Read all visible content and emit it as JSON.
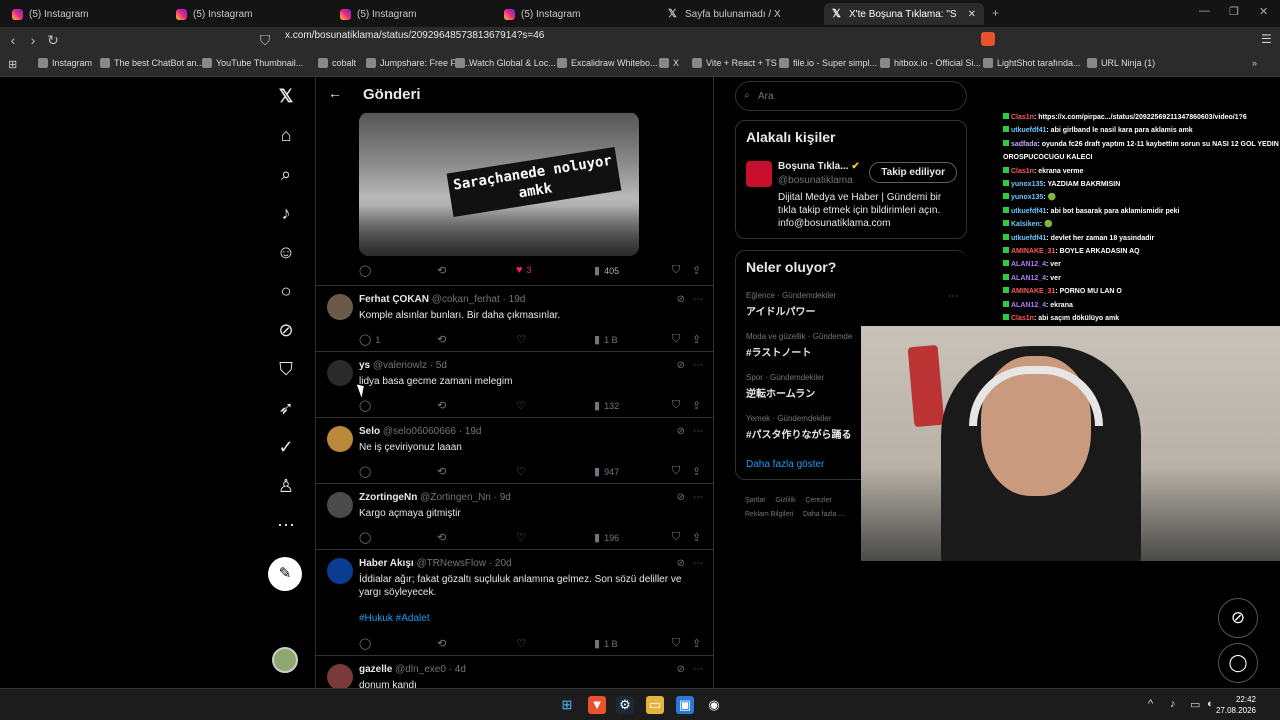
{
  "browser": {
    "tabs": [
      {
        "label": "(5) Instagram",
        "icon": "instagram-icon"
      },
      {
        "label": "(5) Instagram",
        "icon": "instagram-icon"
      },
      {
        "label": "(5) Instagram",
        "icon": "instagram-icon"
      },
      {
        "label": "(5) Instagram",
        "icon": "instagram-icon"
      },
      {
        "label": "Sayfa bulunamadı / X",
        "icon": "x-icon"
      },
      {
        "label": "X'te Boşuna Tıklama: \"SON DAKİ",
        "icon": "x-icon"
      }
    ],
    "url": "x.com/bosunatiklama/status/2092964857381367914?s=46",
    "bookmarks": [
      "Instagram",
      "The best ChatBot an...",
      "YouTube Thumbnail...",
      "cobalt",
      "Jumpshare: Free File...",
      "Watch Global & Loc...",
      "Excalidraw Whitebo...",
      "X",
      "Vite + React + TS",
      "file.io - Super simpl...",
      "hitbox.io - Official Si...",
      "LightShot tarafında...",
      "URL Ninja (1)"
    ]
  },
  "feed": {
    "title": "Gönderi",
    "media_caption": "Saraçhanede noluyor amkk",
    "media_actions": {
      "likes": "3",
      "views": "405"
    },
    "tweets": [
      {
        "name": "Ferhat ÇOKAN",
        "handle": "@cokan_ferhat",
        "time": "· 19d",
        "text": "Komple alsınlar bunları. Bir daha çıkmasınlar.",
        "replies": "1",
        "likes": "",
        "views": "1 B"
      },
      {
        "name": "ys",
        "handle": "@valeriowlz",
        "time": "· 5d",
        "text": "lidya basa gecme zamani melegim",
        "replies": "",
        "likes": "",
        "views": "132"
      },
      {
        "name": "Selo",
        "handle": "@selo06060666",
        "time": "· 19d",
        "text": "Ne iş çeviriyonuz laaan",
        "replies": "",
        "likes": "",
        "views": "947"
      },
      {
        "name": "ZzortingeNn",
        "handle": "@Zortingen_Nn",
        "time": "· 9d",
        "text": "Kargo açmaya gitmiştir",
        "replies": "",
        "likes": "",
        "views": "196"
      },
      {
        "name": "Haber Akışı",
        "handle": "@TRNewsFlow",
        "time": "· 20d",
        "text": "İddialar ağır; fakat gözaltı suçluluk anlamına gelmez. Son sözü deliller ve yargı söyleyecek.",
        "tags": "#Hukuk #Adalet",
        "replies": "",
        "likes": "",
        "views": "1 B"
      },
      {
        "name": "gazelle",
        "handle": "@dln_exe0",
        "time": "· 4d",
        "text": "donum kandı",
        "replies": "",
        "likes": "",
        "views": ""
      }
    ]
  },
  "sidebar": {
    "search_placeholder": "Ara",
    "related": {
      "title": "Alakalı kişiler",
      "name": "Boşuna Tıkla...",
      "handle": "@bosunatiklama",
      "follow_label": "Takip ediliyor",
      "bio": "Dijital Medya ve Haber | Gündemi bir tıkla takip etmek için bildirimleri açın. info@bosunatiklama.com"
    },
    "trends": {
      "title": "Neler oluyor?",
      "items": [
        {
          "cat": "Eğlence · Gündemdekiler",
          "tag": "アイドルパワー"
        },
        {
          "cat": "Moda ve güzellik · Gündemde",
          "tag": "#ラストノート"
        },
        {
          "cat": "Spor · Gündemdekiler",
          "tag": "逆転ホームラン"
        },
        {
          "cat": "Yemek · Gündemdekiler",
          "tag": "#パスタ作りながら踊る"
        }
      ],
      "show_more": "Daha fazla göster"
    },
    "footer": [
      "Şartlar",
      "Gizlilik",
      "Çerezler",
      "Reklam Bilgileri",
      "Daha fazla ..."
    ]
  },
  "chat": [
    {
      "user": "Clas1n",
      "cls": "r",
      "msg": ": https://x.com/pirpac.../status/20922569211347860603/video/1?6"
    },
    {
      "user": "utkuefdf41",
      "cls": "u",
      "msg": ": abi girlband le nasil kara para aklamis amk"
    },
    {
      "user": "sadfada",
      "cls": "o",
      "msg": ": oyunda fc26 draft yaptım 12-11 kaybettim sorun su NASI 12 GOL YEDIN OROSPUCOCUGU KALECI"
    },
    {
      "user": "Clas1n",
      "cls": "r",
      "msg": ": ekrana verme"
    },
    {
      "user": "yunox135",
      "cls": "u",
      "msg": ": YAZDIAM BAKRMISIN"
    },
    {
      "user": "yunox135",
      "cls": "u",
      "msg": ": 🟢"
    },
    {
      "user": "utkuefdf41",
      "cls": "u",
      "msg": ": abi bot basarak para aklamismidir peki"
    },
    {
      "user": "Kalsiken",
      "cls": "u",
      "msg": ": 🟢"
    },
    {
      "user": "utkuefdf41",
      "cls": "u",
      "msg": ": devlet her zaman 18 yasindadir"
    },
    {
      "user": "AMINAKE_31",
      "cls": "r",
      "msg": ": BOYLE ARKADASIN AQ"
    },
    {
      "user": "ALAN12_4",
      "cls": "p",
      "msg": ": ver"
    },
    {
      "user": "ALAN12_4",
      "cls": "p",
      "msg": ": ver"
    },
    {
      "user": "AMINAKE_31",
      "cls": "r",
      "msg": ": PORNO MU LAN O"
    },
    {
      "user": "ALAN12_4",
      "cls": "p",
      "msg": ": ekrana"
    },
    {
      "user": "Clas1n",
      "cls": "r",
      "msg": ": abi saçım dökülüyo amk"
    }
  ],
  "taskbar": {
    "time": "22:42",
    "date": "27.08.2026"
  }
}
